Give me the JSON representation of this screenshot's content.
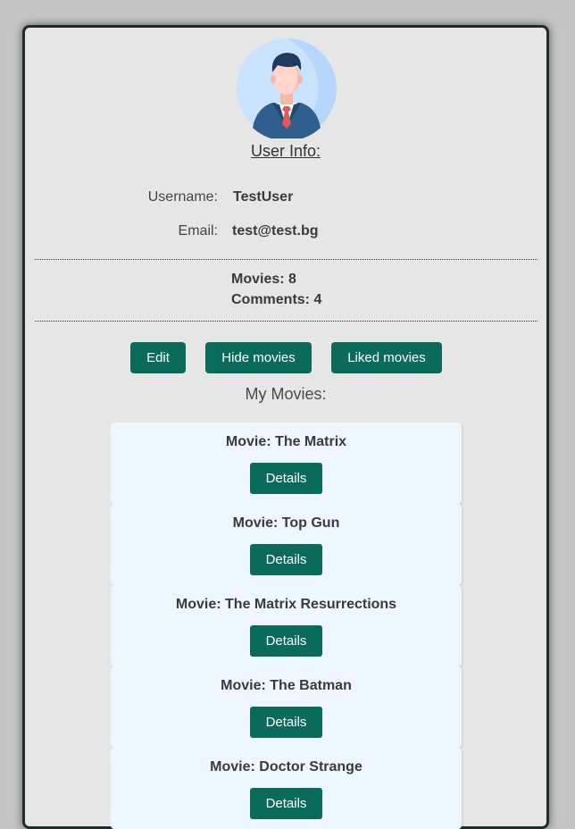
{
  "profile": {
    "title": "User Info:",
    "username_label": "Username:",
    "username_value": "TestUser",
    "email_label": "Email:",
    "email_value": "test@test.bg"
  },
  "stats": {
    "movies": "Movies: 8",
    "comments": "Comments: 4"
  },
  "actions": {
    "edit_label": "Edit",
    "hide_movies_label": "Hide movies",
    "liked_movies_label": "Liked movies"
  },
  "movies_section": {
    "title": "My Movies:",
    "details_label": "Details",
    "items": [
      {
        "title": "Movie: The Matrix"
      },
      {
        "title": "Movie: Top Gun"
      },
      {
        "title": "Movie: The Matrix Resurrections"
      },
      {
        "title": "Movie: The Batman"
      },
      {
        "title": "Movie: Doctor Strange"
      }
    ]
  },
  "colors": {
    "primary_button": "#0b6b5a",
    "card_background": "#e6e6e6",
    "movie_card_background": "#eef7ff"
  },
  "icons": {
    "avatar": "user-avatar-icon"
  }
}
